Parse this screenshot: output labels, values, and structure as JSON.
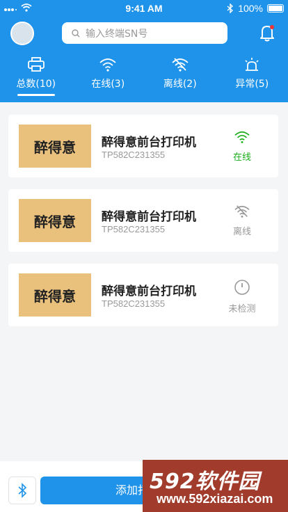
{
  "status_bar": {
    "time": "9:41 AM",
    "battery": "100%"
  },
  "search": {
    "placeholder": "输入终端SN号"
  },
  "tabs": [
    {
      "label": "总数(10)",
      "icon": "printer-icon",
      "active": true
    },
    {
      "label": "在线(3)",
      "icon": "wifi-icon"
    },
    {
      "label": "离线(2)",
      "icon": "wifi-off-icon"
    },
    {
      "label": "异常(5)",
      "icon": "alarm-icon"
    }
  ],
  "printers": [
    {
      "logo_text": "醉得意",
      "name": "醉得意前台打印机",
      "sn": "TP582C231355",
      "status": "在线",
      "status_color": "#1aad19",
      "icon": "wifi-icon"
    },
    {
      "logo_text": "醉得意",
      "name": "醉得意前台打印机",
      "sn": "TP582C231355",
      "status": "离线",
      "status_color": "#999999",
      "icon": "wifi-off-icon"
    },
    {
      "logo_text": "醉得意",
      "name": "醉得意前台打印机",
      "sn": "TP582C231355",
      "status": "未检测",
      "status_color": "#999999",
      "icon": "clock-icon"
    }
  ],
  "bottom": {
    "add_label": "添加打印机"
  },
  "watermark": {
    "title": "592软件园",
    "url": "www.592xiazai.com"
  },
  "colors": {
    "primary": "#1f93e9",
    "online": "#1aad19",
    "muted": "#999999"
  }
}
